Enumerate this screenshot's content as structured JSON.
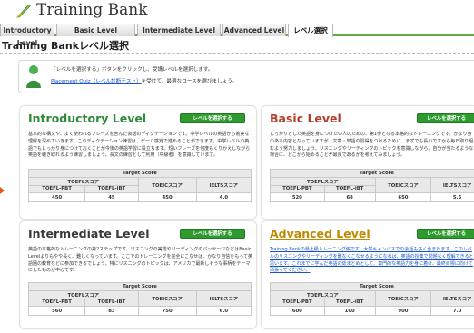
{
  "app": {
    "title": "Training Bank"
  },
  "tabs": [
    {
      "label": "Introductory Level",
      "active": false
    },
    {
      "label": "Basic Level",
      "active": false
    },
    {
      "label": "Intermediate Level",
      "active": false
    },
    {
      "label": "Advanced Level",
      "active": false
    },
    {
      "label": "レベル選択",
      "active": true
    }
  ],
  "page": {
    "title": "Training Bankレベル選択"
  },
  "notice": {
    "line1": "「レベルを選択する」ボタンをクリックし、受講レベルを選択します。",
    "line2_link": "Placement Quiz（レベル診断テスト）",
    "line2_rest": "を受けて、最適なコースを選びましょう。"
  },
  "score_headers": {
    "target": "Target Score",
    "toefl": "TOEFLスコア",
    "toefl_pbt": "TOEFL-PBT",
    "toefl_ibt": "TOEFL-iBT",
    "toeic": "TOEICスコア",
    "ielts": "IELTSスコア"
  },
  "cards": [
    {
      "title": "Introductory Level",
      "button": "レベルを選択する",
      "description": "基本的な構文や、よく使われるフレーズを含んだ会話のディクテーションです。中学レベルの英語から着実な理解を深めていきます。このディクテーション練習は、ゲーム感覚で進めることができます。中学レベルの英語でもしっかり身につけておくことが今後の英語学習に役立ちます。短いフレーズを何度もくりかえしながら英語を聴き取れるよう練習しましょう。長文の練習として利用（中級者）を意識しています。",
      "scores": {
        "toefl_pbt": "450",
        "toefl_ibt": "45",
        "toeic": "450",
        "ielts": "4.0"
      }
    },
    {
      "title": "Basic Level",
      "button": "レベルを選択する",
      "description": "しっかりとした英語を身につけたい人のための、第1歩となる本格的なトレーニングです。かなり身のある内容となっていますが、文章・単語の習得をつけるために、まずでも長いですから毎日取り組むよう努力しましょう。リスニングやリーディングのトピックを意識しながら、自分が当たるような場合に、どこから始めることが最良であるかを考えてみましょう。",
      "scores": {
        "toefl_pbt": "520",
        "toefl_ibt": "68",
        "toeic": "650",
        "ielts": "5.5"
      }
    },
    {
      "title": "Intermediate Level",
      "button": "レベルを選択する",
      "description": "英語の本格的なトレーニングの第2ステップです。リスニングの実践やリーディングのパッセージなどはBasic Levelよりもやや長く、難しくなっています。ここでのトレーニングを完全にこなせば、かなり自信をもって英語圏の教育などに参加できるでしょう。特にリスニングのトピックは、アメリカで最新しそうな事柄をテーマにしたものが中心です。",
      "scores": {
        "toefl_pbt": "560",
        "toefl_ibt": "83",
        "toeic": "750",
        "ielts": "6.0"
      }
    },
    {
      "title": "Advanced Level",
      "button": "レベルを選択する",
      "description": "Training Bankの最上級トレーニング編です。大学キャンパスでの会話も多く含まれます。このレベルのリスニングやリーディングを難なくこなせるようになれば、英語の授業で問題なく理解できると思います。これまでに学んだ英語の総まとめとして、専門的な英語力を身に着け、最終目標に向けて頑張ってください。",
      "scores": {
        "toefl_pbt": "600",
        "toefl_ibt": "100",
        "toeic": "900",
        "ielts": "7.0"
      }
    }
  ],
  "colors": {
    "accent_green": "#6aa84f",
    "intro_title": "#2e8b3a",
    "basic_title": "#b5402a",
    "intermediate_title": "#3a3a3a",
    "advanced_title": "#c08a00",
    "button_green": "#2f9a2f",
    "link_blue": "#1a55c8"
  },
  "icons": {
    "logo": "quill-icon",
    "notice": "person-icon",
    "pointer": "arrow-right-icon"
  }
}
